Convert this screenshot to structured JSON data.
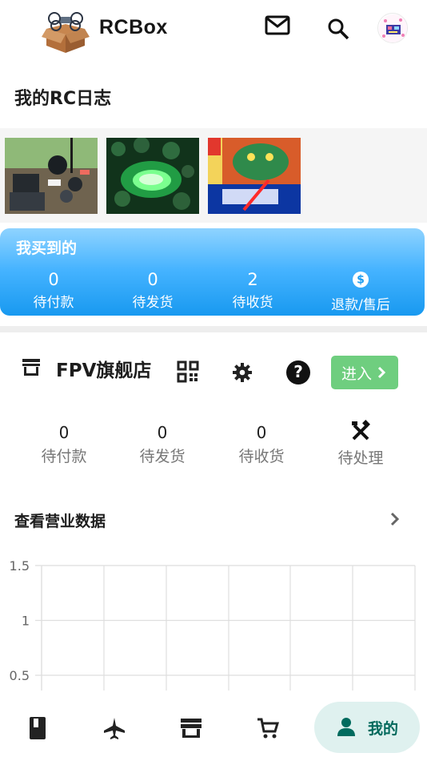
{
  "header": {
    "app_title": "RCBox",
    "icons": [
      "drone-box-logo",
      "mail-icon",
      "search-icon",
      "avatar"
    ]
  },
  "rc_log": {
    "title": "我的RC日志",
    "thumbnails": [
      "rc-workbench-photo",
      "green-glow-photo",
      "game-cover-photo"
    ]
  },
  "purchases": {
    "title": "我买到的",
    "items": [
      {
        "count": "0",
        "label": "待付款"
      },
      {
        "count": "0",
        "label": "待发货"
      },
      {
        "count": "2",
        "label": "待收货"
      },
      {
        "label": "退款/售后",
        "icon": "dollar-circle-icon"
      }
    ]
  },
  "store": {
    "name": "FPV旗舰店",
    "enter_label": "进入",
    "orders": [
      {
        "count": "0",
        "label": "待付款"
      },
      {
        "count": "0",
        "label": "待发货"
      },
      {
        "count": "0",
        "label": "待收货"
      },
      {
        "label": "待处理",
        "icon": "tools-icon"
      }
    ],
    "business_data_label": "查看营业数据"
  },
  "chart_data": {
    "type": "line",
    "y_ticks": [
      "1.5",
      "1",
      "0.5"
    ],
    "ylim": [
      0,
      1.5
    ],
    "grid": true,
    "series": []
  },
  "bottom_nav": {
    "active_label": "我的",
    "items": [
      "book-icon",
      "airplane-icon",
      "store-icon",
      "cart-icon",
      "person-icon"
    ]
  },
  "colors": {
    "accent": "#1899f0",
    "enter_green": "#6fce7f",
    "nav_active_bg": "#dff1ef",
    "nav_active_text": "#00695c"
  }
}
